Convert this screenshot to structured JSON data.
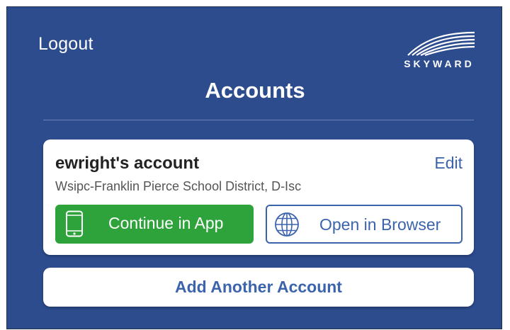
{
  "header": {
    "logout_label": "Logout",
    "title": "Accounts",
    "logo_text": "SKYWARD"
  },
  "account": {
    "name": "ewright's account",
    "edit_label": "Edit",
    "district": "Wsipc-Franklin Pierce School District, D-Isc",
    "continue_label": "Continue in App",
    "browser_label": "Open in Browser"
  },
  "add_account_label": "Add Another Account",
  "icons": {
    "continue": "phone-icon",
    "browser": "globe-icon"
  },
  "colors": {
    "background": "#2d4c8d",
    "accent": "#3c64ad",
    "primary_button": "#2fa33b"
  }
}
